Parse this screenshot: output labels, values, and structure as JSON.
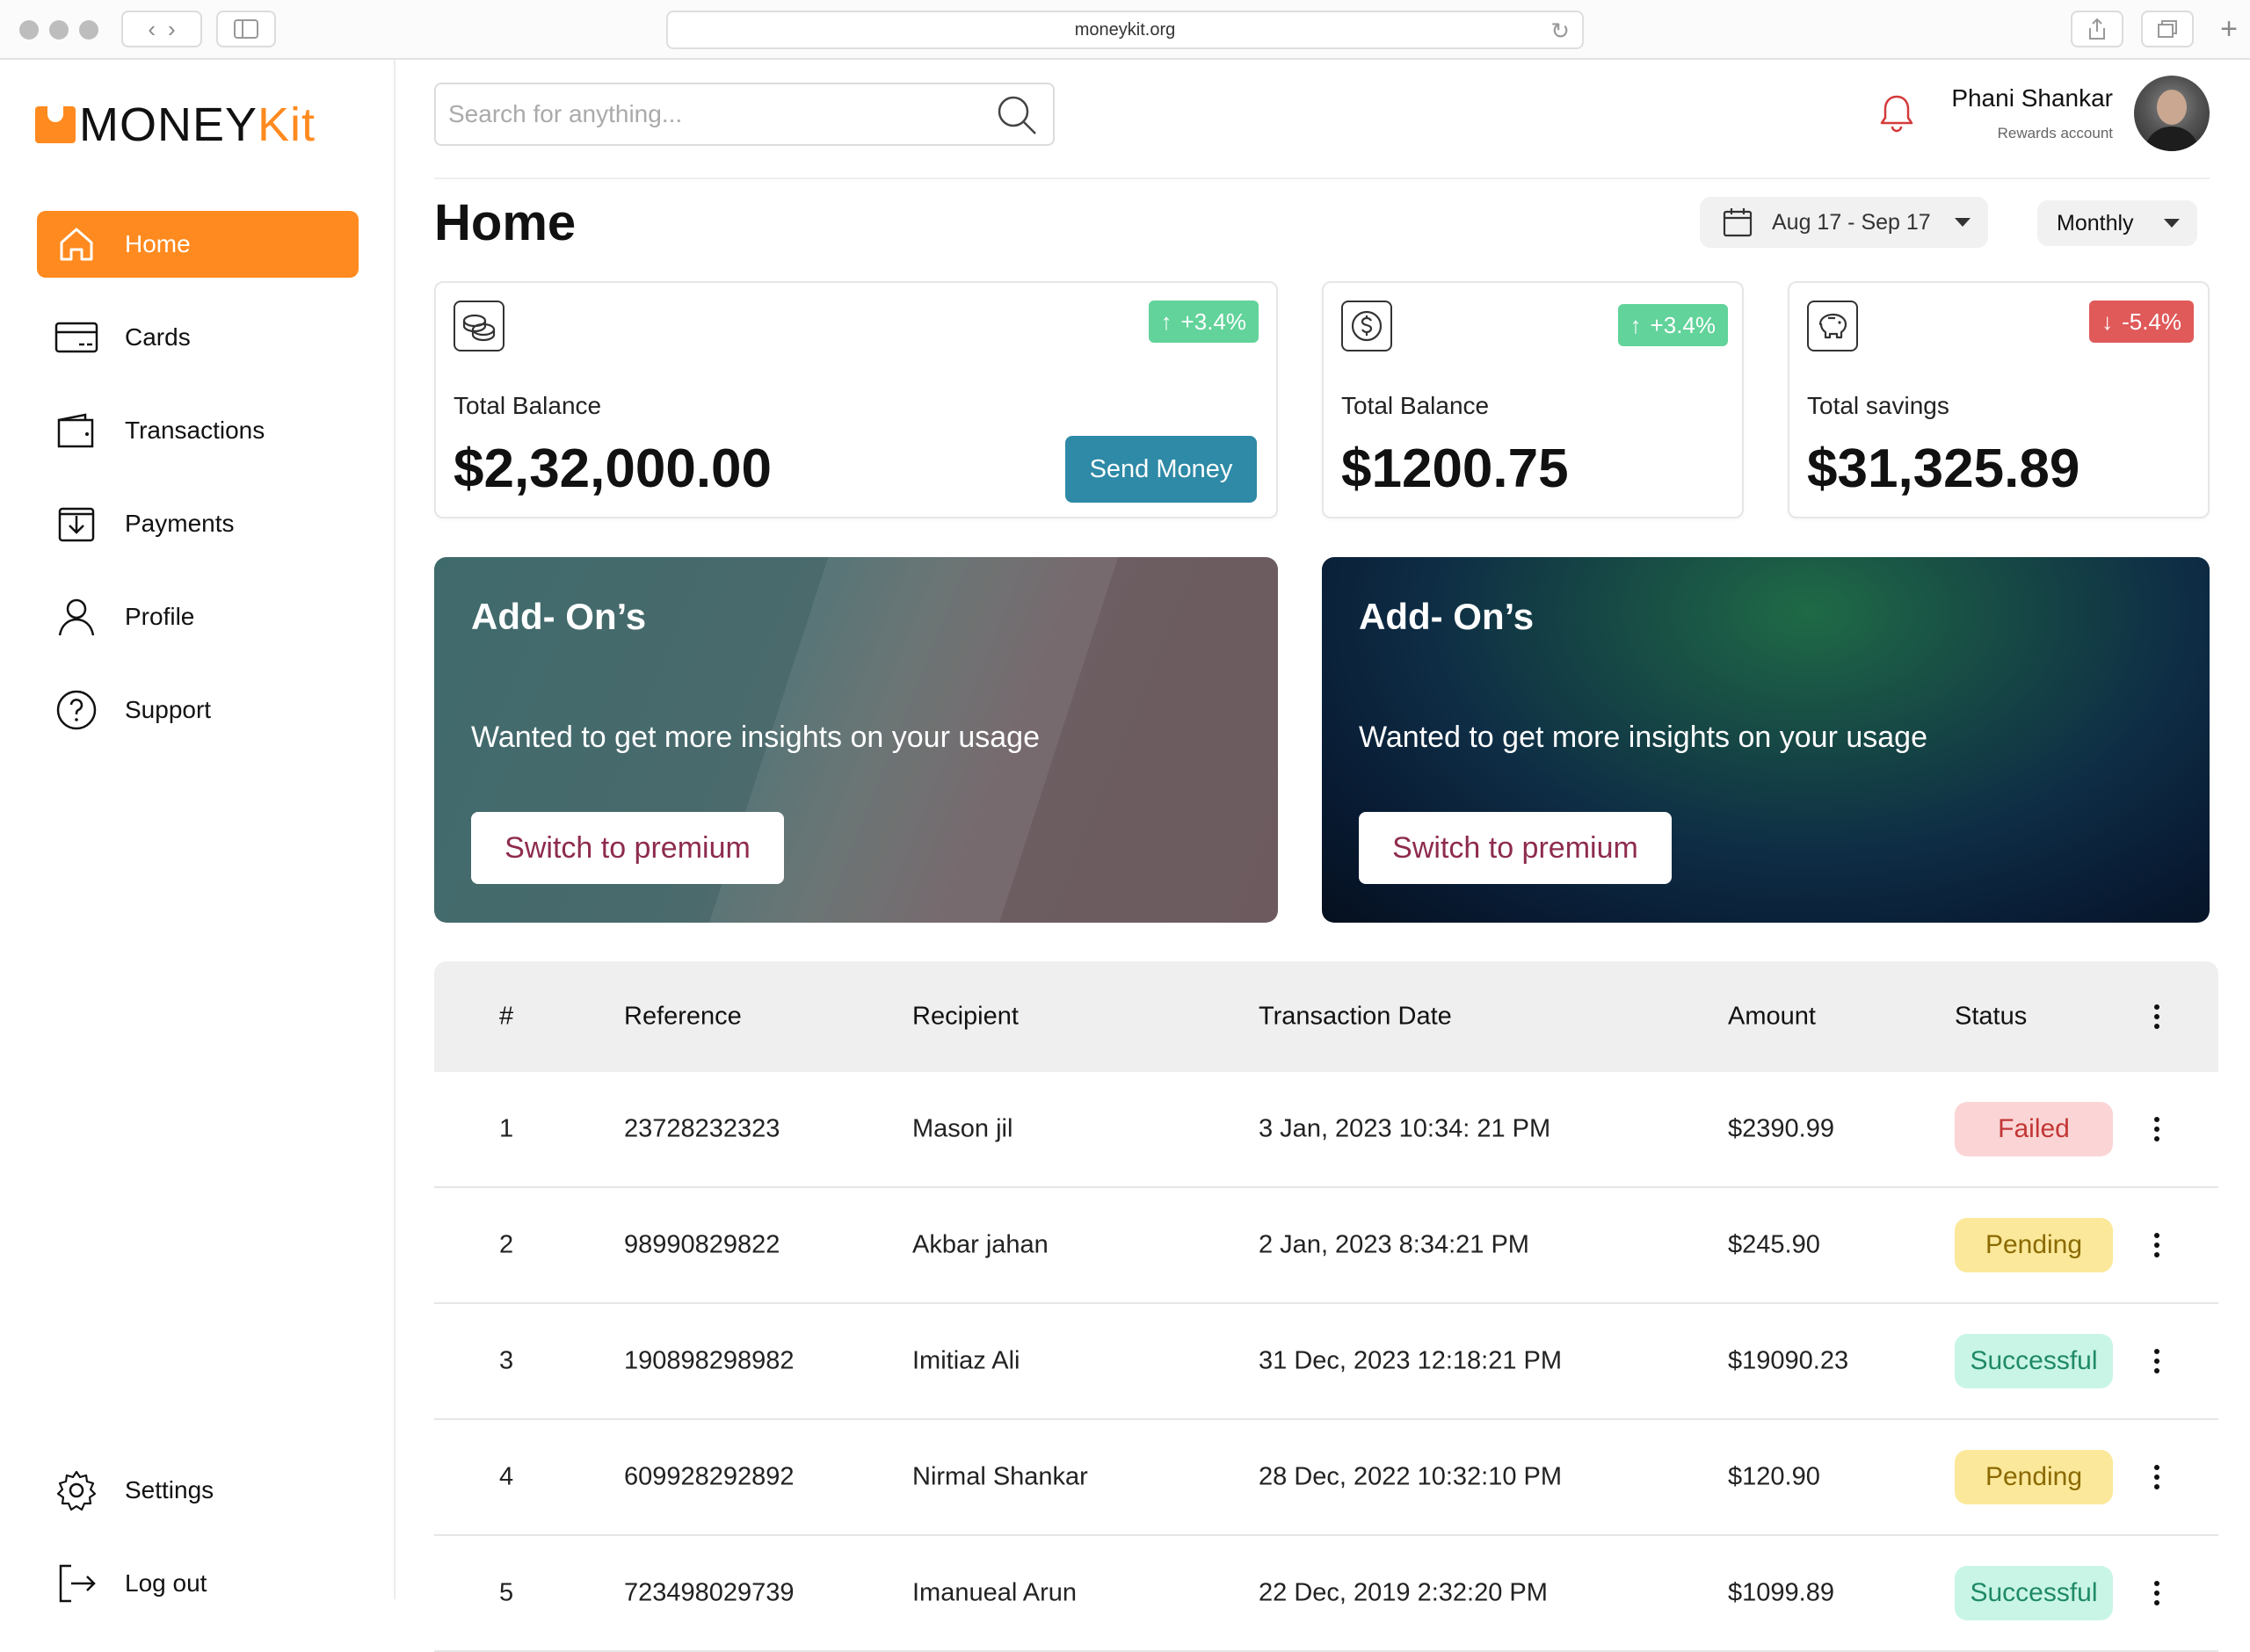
{
  "browser": {
    "url": "moneykit.org"
  },
  "brand": {
    "name_main": "MONEY",
    "name_accent": "Kit",
    "accent_color": "#ff8a1f"
  },
  "sidebar": {
    "items": [
      {
        "label": "Home",
        "icon": "home-icon",
        "active": true
      },
      {
        "label": "Cards",
        "icon": "card-icon"
      },
      {
        "label": "Transactions",
        "icon": "wallet-icon"
      },
      {
        "label": "Payments",
        "icon": "download-icon"
      },
      {
        "label": "Profile",
        "icon": "user-icon"
      },
      {
        "label": "Support",
        "icon": "help-icon"
      }
    ],
    "bottom": [
      {
        "label": "Settings",
        "icon": "gear-icon"
      },
      {
        "label": "Log out",
        "icon": "logout-icon"
      }
    ]
  },
  "header": {
    "search_placeholder": "Search for anything...",
    "user_name": "Phani Shankar",
    "user_sub": "Rewards account"
  },
  "page": {
    "title": "Home",
    "date_range": "Aug 17 - Sep 17",
    "period": "Monthly"
  },
  "stats": [
    {
      "label": "Total Balance",
      "value": "$2,32,000.00",
      "change": "+3.4%",
      "trend": "up",
      "icon": "coins-icon",
      "action": "Send Money"
    },
    {
      "label": "Total Balance",
      "value": "$1200.75",
      "change": "+3.4%",
      "trend": "up",
      "icon": "dollar-icon"
    },
    {
      "label": "Total savings",
      "value": "$31,325.89",
      "change": "-5.4%",
      "trend": "down",
      "icon": "piggy-bank-icon"
    }
  ],
  "addons": [
    {
      "title": "Add- On’s",
      "subtitle": "Wanted to get more insights on your usage",
      "button": "Switch to premium"
    },
    {
      "title": "Add- On’s",
      "subtitle": "Wanted to get more insights on your usage",
      "button": "Switch to premium"
    }
  ],
  "table": {
    "columns": [
      "#",
      "Reference",
      "Recipient",
      "Transaction Date",
      "Amount",
      "Status"
    ],
    "rows": [
      {
        "num": "1",
        "reference": "23728232323",
        "recipient": "Mason jil",
        "date": "3 Jan, 2023 10:34: 21 PM",
        "amount": "$2390.99",
        "status": "Failed"
      },
      {
        "num": "2",
        "reference": "98990829822",
        "recipient": "Akbar jahan",
        "date": "2 Jan, 2023 8:34:21 PM",
        "amount": "$245.90",
        "status": "Pending"
      },
      {
        "num": "3",
        "reference": "190898298982",
        "recipient": "Imitiaz Ali",
        "date": "31 Dec, 2023 12:18:21 PM",
        "amount": "$19090.23",
        "status": "Successful"
      },
      {
        "num": "4",
        "reference": "609928292892",
        "recipient": "Nirmal Shankar",
        "date": "28 Dec, 2022 10:32:10 PM",
        "amount": "$120.90",
        "status": "Pending"
      },
      {
        "num": "5",
        "reference": "723498029739",
        "recipient": "Imanueal Arun",
        "date": "22 Dec, 2019 2:32:20 PM",
        "amount": "$1099.89",
        "status": "Successful"
      }
    ]
  }
}
